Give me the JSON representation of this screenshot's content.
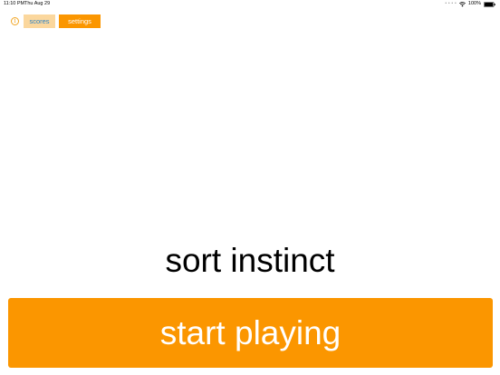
{
  "status_bar": {
    "time": "11:10 PM",
    "date": "Thu Aug 29",
    "dots": "• • • •",
    "battery": "100%"
  },
  "toolbar": {
    "info_icon": "info-icon",
    "info_glyph": "i",
    "scores_label": "scores",
    "settings_label": "settings"
  },
  "main": {
    "title": "sort instinct",
    "start_label": "start playing"
  },
  "colors": {
    "accent_orange": "#fb9600",
    "light_orange": "#fbd79d",
    "link_blue": "#2f84c6"
  }
}
